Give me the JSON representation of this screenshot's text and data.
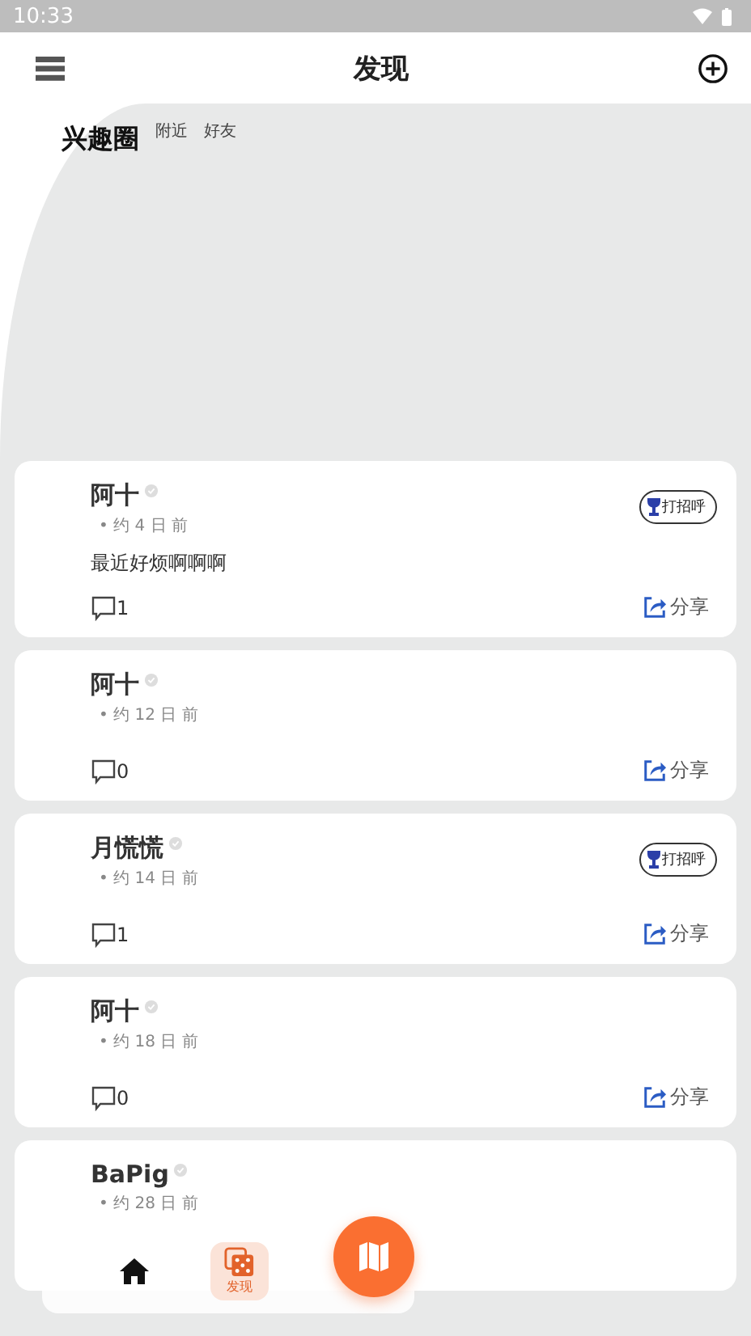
{
  "status_bar": {
    "time": "10:33"
  },
  "header": {
    "title": "发现"
  },
  "tabs": [
    {
      "label": "兴趣圈",
      "selected": true
    },
    {
      "label": "附近",
      "selected": false
    },
    {
      "label": "好友",
      "selected": false
    }
  ],
  "posts": [
    {
      "name": "阿十",
      "time": "• 约 4 日 前",
      "text": "最近好烦啊啊啊",
      "comments": "1",
      "greet": "打招呼",
      "share": "分享"
    },
    {
      "name": "阿十",
      "time": "• 约 12 日 前",
      "comments": "0",
      "share": "分享"
    },
    {
      "name": "月慌慌",
      "time": "• 约 14 日 前",
      "comments": "1",
      "greet": "打招呼",
      "share": "分享"
    },
    {
      "name": "阿十",
      "time": "• 约 18 日 前",
      "comments": "0",
      "share": "分享"
    },
    {
      "name": "BaPig",
      "time": "• 约 28 日 前"
    }
  ],
  "bottom_nav": [
    {
      "kind": "home",
      "selected": false
    },
    {
      "kind": "discover",
      "label": "发现",
      "selected": true
    },
    {
      "kind": "map",
      "selected": false
    }
  ]
}
